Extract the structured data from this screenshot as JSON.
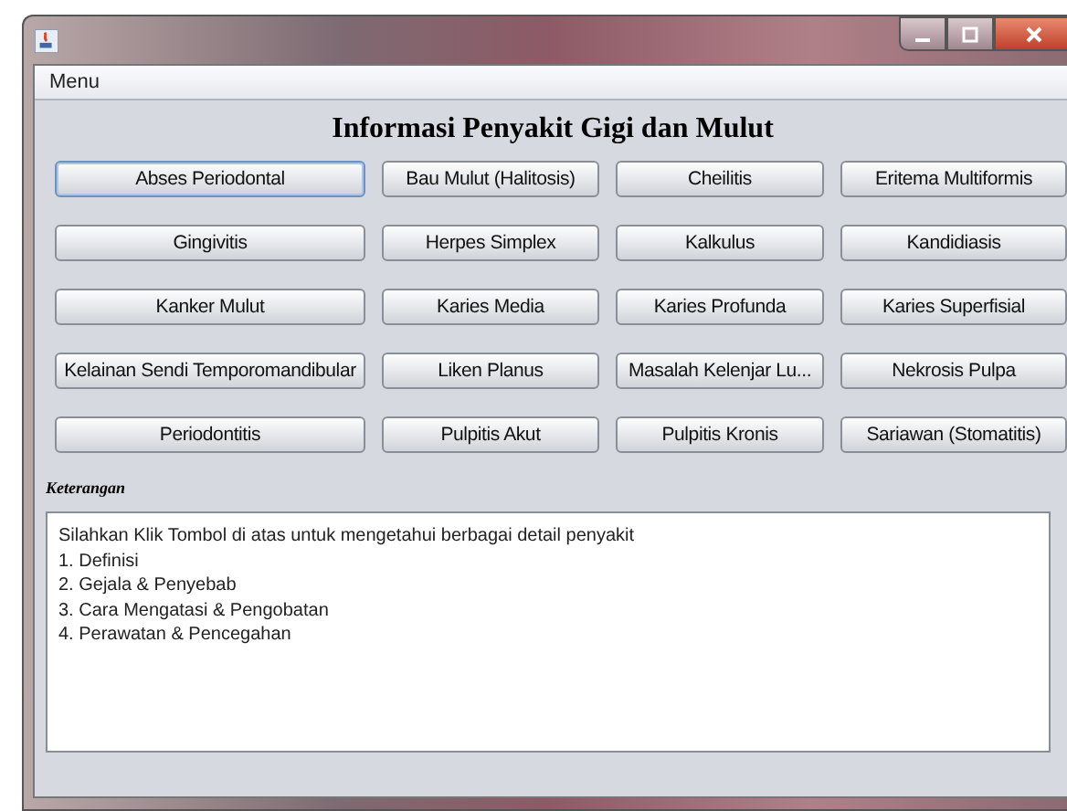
{
  "menu_bar": {
    "items": [
      "Menu"
    ]
  },
  "heading": "Informasi Penyakit Gigi dan Mulut",
  "buttons": [
    {
      "label": "Abses Periodontal",
      "focused": true
    },
    {
      "label": "Bau Mulut (Halitosis)",
      "focused": false
    },
    {
      "label": "Cheilitis",
      "focused": false
    },
    {
      "label": "Eritema Multiformis",
      "focused": false
    },
    {
      "label": "Gingivitis",
      "focused": false
    },
    {
      "label": "Herpes Simplex",
      "focused": false
    },
    {
      "label": "Kalkulus",
      "focused": false
    },
    {
      "label": "Kandidiasis",
      "focused": false
    },
    {
      "label": "Kanker Mulut",
      "focused": false
    },
    {
      "label": "Karies Media",
      "focused": false
    },
    {
      "label": "Karies Profunda",
      "focused": false
    },
    {
      "label": "Karies Superfisial",
      "focused": false
    },
    {
      "label": "Kelainan Sendi Temporomandibular",
      "focused": false
    },
    {
      "label": "Liken Planus",
      "focused": false
    },
    {
      "label": "Masalah Kelenjar Lu...",
      "focused": false
    },
    {
      "label": "Nekrosis Pulpa",
      "focused": false
    },
    {
      "label": "Periodontitis",
      "focused": false
    },
    {
      "label": "Pulpitis Akut",
      "focused": false
    },
    {
      "label": "Pulpitis Kronis",
      "focused": false
    },
    {
      "label": "Sariawan (Stomatitis)",
      "focused": false
    }
  ],
  "keterangan": {
    "label": "Keterangan",
    "lines": [
      "Silahkan Klik Tombol di atas untuk mengetahui berbagai detail penyakit",
      "1. Definisi",
      "2. Gejala & Penyebab",
      "3. Cara Mengatasi & Pengobatan",
      "4. Perawatan & Pencegahan"
    ]
  }
}
